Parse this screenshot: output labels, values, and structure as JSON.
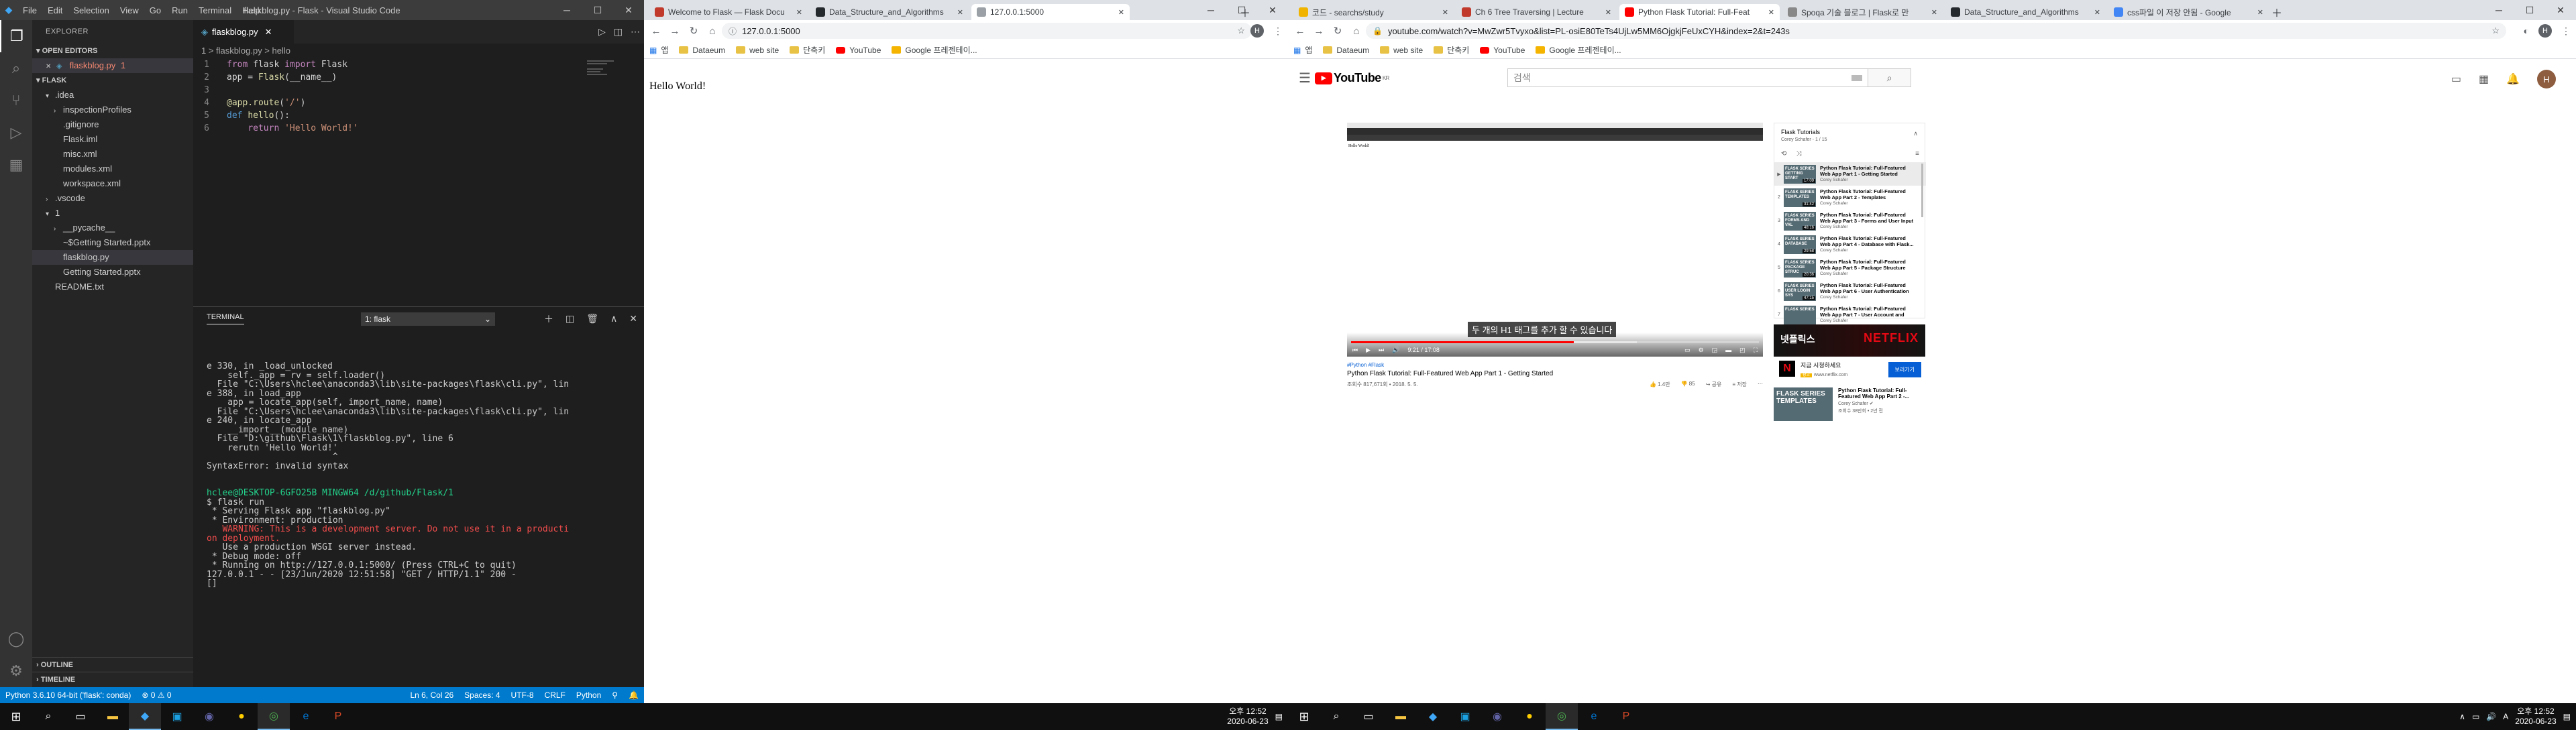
{
  "vscode": {
    "title": "flaskblog.py - Flask - Visual Studio Code",
    "menu": [
      "File",
      "Edit",
      "Selection",
      "View",
      "Go",
      "Run",
      "Terminal",
      "Help"
    ],
    "explorer_label": "EXPLORER",
    "open_editors_label": "OPEN EDITORS",
    "open_editor_file": "flaskblog.py",
    "open_editor_badge": "1",
    "folder_label": "FLASK",
    "tree": [
      {
        "label": ".idea",
        "indent": 1,
        "caret": "v",
        "color": "#ccc"
      },
      {
        "label": "inspectionProfiles",
        "indent": 2,
        "caret": ">",
        "color": "#ccc"
      },
      {
        "label": ".gitignore",
        "indent": 2,
        "caret": "",
        "color": "#ccc"
      },
      {
        "label": "Flask.iml",
        "indent": 2,
        "caret": "",
        "color": "#ccc"
      },
      {
        "label": "misc.xml",
        "indent": 2,
        "caret": "",
        "color": "#ccc"
      },
      {
        "label": "modules.xml",
        "indent": 2,
        "caret": "",
        "color": "#ccc"
      },
      {
        "label": "workspace.xml",
        "indent": 2,
        "caret": "",
        "color": "#ccc"
      },
      {
        "label": ".vscode",
        "indent": 1,
        "caret": ">",
        "color": "#ccc"
      },
      {
        "label": "1",
        "indent": 1,
        "caret": "v",
        "color": "#ccc"
      },
      {
        "label": "__pycache__",
        "indent": 2,
        "caret": ">",
        "color": "#ccc"
      },
      {
        "label": "~$Getting Started.pptx",
        "indent": 2,
        "caret": "",
        "color": "#ccc"
      },
      {
        "label": "flaskblog.py",
        "indent": 2,
        "caret": "",
        "color": "#ccc"
      },
      {
        "label": "Getting Started.pptx",
        "indent": 2,
        "caret": "",
        "color": "#ccc"
      },
      {
        "label": "README.txt",
        "indent": 1,
        "caret": "",
        "color": "#ccc"
      }
    ],
    "outline_label": "OUTLINE",
    "timeline_label": "TIMELINE",
    "tab_label": "flaskblog.py",
    "breadcrumb": "1 > flaskblog.py > hello",
    "code": [
      {
        "n": "1",
        "parts": [
          {
            "t": "from",
            "c": "kw"
          },
          {
            "t": " flask ",
            "c": ""
          },
          {
            "t": "import",
            "c": "kw"
          },
          {
            "t": " Flask",
            "c": ""
          }
        ]
      },
      {
        "n": "2",
        "parts": [
          {
            "t": "app = ",
            "c": ""
          },
          {
            "t": "Flask",
            "c": "fn"
          },
          {
            "t": "(__name__)",
            "c": ""
          }
        ]
      },
      {
        "n": "3",
        "parts": []
      },
      {
        "n": "4",
        "parts": [
          {
            "t": "@app.route",
            "c": "dec"
          },
          {
            "t": "(",
            "c": ""
          },
          {
            "t": "'/'",
            "c": "str"
          },
          {
            "t": ")",
            "c": ""
          }
        ]
      },
      {
        "n": "5",
        "parts": [
          {
            "t": "def",
            "c": "kw2"
          },
          {
            "t": " ",
            "c": ""
          },
          {
            "t": "hello",
            "c": "fn"
          },
          {
            "t": "():",
            "c": ""
          }
        ]
      },
      {
        "n": "6",
        "parts": [
          {
            "t": "    ",
            "c": ""
          },
          {
            "t": "return",
            "c": "kw"
          },
          {
            "t": " ",
            "c": ""
          },
          {
            "t": "'Hello World!'",
            "c": "str"
          }
        ]
      }
    ],
    "panel_label": "TERMINAL",
    "terminal_select": "1: flask",
    "terminal": [
      {
        "t": "e 330, in _load_unlocked",
        "c": ""
      },
      {
        "t": "    self._app = rv = self.loader()",
        "c": ""
      },
      {
        "t": "  File \"C:\\Users\\hclee\\anaconda3\\lib\\site-packages\\flask\\cli.py\", lin",
        "c": ""
      },
      {
        "t": "e 388, in load_app",
        "c": ""
      },
      {
        "t": "    app = locate_app(self, import_name, name)",
        "c": ""
      },
      {
        "t": "  File \"C:\\Users\\hclee\\anaconda3\\lib\\site-packages\\flask\\cli.py\", lin",
        "c": ""
      },
      {
        "t": "e 240, in locate_app",
        "c": ""
      },
      {
        "t": "    __import__(module_name)",
        "c": ""
      },
      {
        "t": "  File \"D:\\github\\Flask\\1\\flaskblog.py\", line 6",
        "c": ""
      },
      {
        "t": "    rerutn 'Hello World!'",
        "c": ""
      },
      {
        "t": "                        ^",
        "c": ""
      },
      {
        "t": "SyntaxError: invalid syntax",
        "c": ""
      },
      {
        "t": "",
        "c": ""
      },
      {
        "t": "",
        "c": ""
      },
      {
        "t": "hclee@DESKTOP-6GFO25B MINGW64 /d/github/Flask/1",
        "c": "prompt"
      },
      {
        "t": "$ flask run",
        "c": ""
      },
      {
        "t": " * Serving Flask app \"flaskblog.py\"",
        "c": ""
      },
      {
        "t": " * Environment: production",
        "c": ""
      },
      {
        "t": "   WARNING: This is a development server. Do not use it in a producti",
        "c": "t-red"
      },
      {
        "t": "on deployment.",
        "c": "t-red"
      },
      {
        "t": "   Use a production WSGI server instead.",
        "c": ""
      },
      {
        "t": " * Debug mode: off",
        "c": ""
      },
      {
        "t": " * Running on http://127.0.0.1:5000/ (Press CTRL+C to quit)",
        "c": "url"
      },
      {
        "t": "127.0.0.1 - - [23/Jun/2020 12:51:58] \"GET / HTTP/1.1\" 200 -",
        "c": ""
      },
      {
        "t": "[]",
        "c": ""
      }
    ],
    "status_left": [
      "Python 3.6.10 64-bit ('flask': conda)",
      "⊗ 0 ⚠ 0"
    ],
    "status_right": [
      "Ln 6, Col 26",
      "Spaces: 4",
      "UTF-8",
      "CRLF",
      "Python",
      "⚲",
      "🔔"
    ]
  },
  "chrome_left": {
    "tabs": [
      {
        "label": "Welcome to Flask — Flask Docu",
        "color": "#c0392b"
      },
      {
        "label": "Data_Structure_and_Algorithms",
        "color": "#24292e"
      },
      {
        "label": "127.0.0.1:5000",
        "color": "#9aa0a6"
      }
    ],
    "url": "127.0.0.1:5000",
    "bookmarks": [
      "앱",
      "Dataeum",
      "web site",
      "단축키",
      "YouTube",
      "Google 프레젠테이..."
    ],
    "page_text": "Hello World!"
  },
  "chrome_right": {
    "tabs": [
      {
        "label": "코드 - searchs/study",
        "color": "#f0b400"
      },
      {
        "label": "Ch 6 Tree Traversing | Lecture",
        "color": "#c0392b"
      },
      {
        "label": "Python Flask Tutorial: Full-Feat",
        "color": "#ff0000"
      },
      {
        "label": "Spoqa 기술 블로그 | Flask로 만",
        "color": "#888"
      },
      {
        "label": "Data_Structure_and_Algorithms",
        "color": "#24292e"
      },
      {
        "label": "css파일 이 저장 안됨 - Google",
        "color": "#4285f4"
      }
    ],
    "url": "youtube.com/watch?v=MwZwr5Tvyxo&list=PL-osiE80TeTs4UjLw5MM6OjgkjFeUxCYH&index=2&t=243s",
    "bookmarks": [
      "앱",
      "Dataeum",
      "web site",
      "단축키",
      "YouTube",
      "Google 프레젠테이..."
    ]
  },
  "youtube": {
    "logo": "YouTube",
    "logo_country": "KR",
    "search_placeholder": "검색",
    "avatar_letter": "H",
    "player": {
      "inner_tabs": "localhost:5000",
      "inner_hello": "Hello World!",
      "subtitle": "두 개의 H1 태그를 추가 할 수 있습니다",
      "time": "9:21 / 17:08",
      "progress": 0.546,
      "loaded": 0.7
    },
    "hashtags": "#Python #Flask",
    "title": "Python Flask Tutorial: Full-Featured Web App Part 1 - Getting Started",
    "views": "조회수 817,671회 • 2018. 5. 5.",
    "actions": {
      "likes": "1.4만",
      "dislikes": "85",
      "share": "공유",
      "save": "저장"
    },
    "playlist": {
      "title": "Flask Tutorials",
      "subtitle": "Corey Schafer - 1 / 15",
      "items": [
        {
          "idx": "▶",
          "thumb": "FLASK SERIES GETTING START",
          "dur": "17:09",
          "title": "Python Flask Tutorial: Full-Featured Web App Part 1 - Getting Started",
          "channel": "Corey Schafer",
          "active": true
        },
        {
          "idx": "2",
          "thumb": "FLASK SERIES TEMPLATES",
          "dur": "31:42",
          "title": "Python Flask Tutorial: Full-Featured Web App Part 2 - Templates",
          "channel": "Corey Schafer",
          "active": false
        },
        {
          "idx": "3",
          "thumb": "FLASK SERIES FORMS AND VAL",
          "dur": "48:16",
          "title": "Python Flask Tutorial: Full-Featured Web App Part 3 - Forms and User Input",
          "channel": "Corey Schafer",
          "active": false
        },
        {
          "idx": "4",
          "thumb": "FLASK SERIES DATABASE",
          "dur": "29:58",
          "title": "Python Flask Tutorial: Full-Featured Web App Part 4 - Database with Flask...",
          "channel": "Corey Schafer",
          "active": false
        },
        {
          "idx": "5",
          "thumb": "FLASK SERIES PACKAGE STRUC",
          "dur": "20:36",
          "title": "Python Flask Tutorial: Full-Featured Web App Part 5 - Package Structure",
          "channel": "Corey Schafer",
          "active": false
        },
        {
          "idx": "6",
          "thumb": "FLASK SERIES USER LOGIN SYS",
          "dur": "47:15",
          "title": "Python Flask Tutorial: Full-Featured Web App Part 6 - User Authentication",
          "channel": "Corey Schafer",
          "active": false
        },
        {
          "idx": "7",
          "thumb": "FLASK SERIES",
          "dur": "",
          "title": "Python Flask Tutorial: Full-Featured Web App Part 7 - User Account and",
          "channel": "Corey Schafer",
          "active": false
        }
      ]
    },
    "banner": {
      "left": "넷플릭스",
      "right": "NETFLIX"
    },
    "ad": {
      "title": "지금 시청하세요",
      "ad_label": "광고",
      "url": "www.netflix.com",
      "button": "보러가기",
      "logo": "N"
    },
    "recommended": {
      "thumb": "FLASK SERIES TEMPLATES",
      "title": "Python Flask Tutorial: Full-Featured Web App Part 2 -...",
      "channel": "Corey Schafer",
      "meta": "조회수 38만회 • 2년 전"
    }
  },
  "taskbar_left": {
    "time": "오후 12:52",
    "date": "2020-06-23"
  },
  "taskbar_right": {
    "time": "오후 12:52",
    "date": "2020-06-23"
  }
}
